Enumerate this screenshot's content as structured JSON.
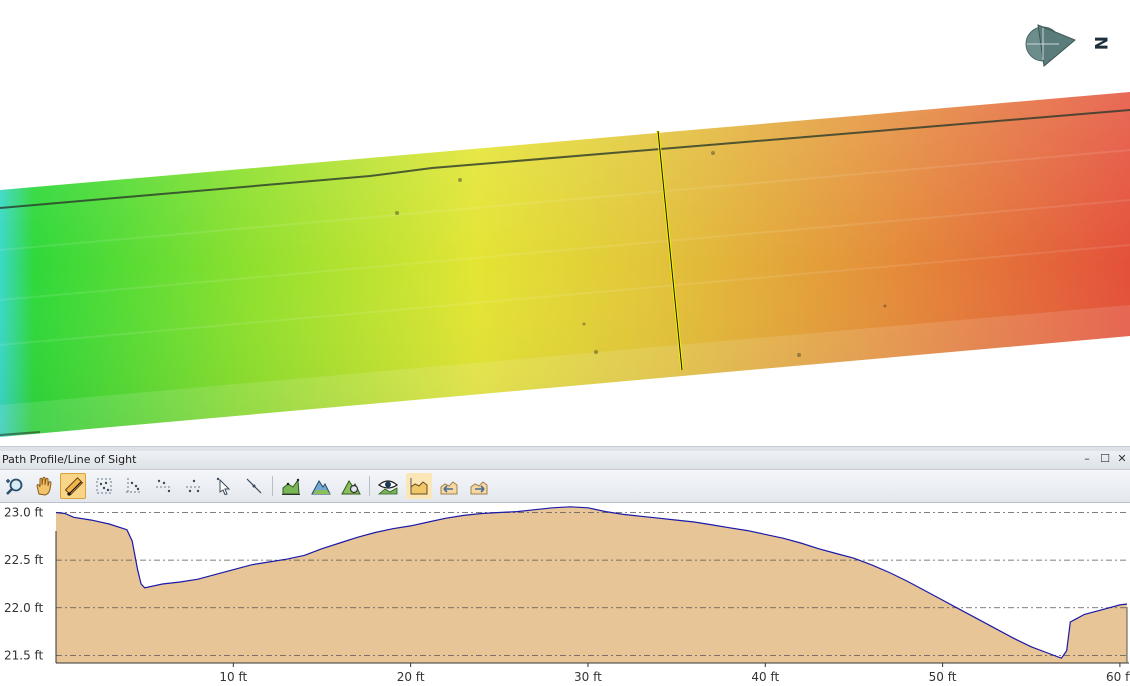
{
  "panel": {
    "title": "Path Profile/Line of Sight",
    "minimize_label": "–",
    "maximize_label": "☐",
    "close_label": "✕"
  },
  "compass": {
    "north_label": "N"
  },
  "toolbar": {
    "tools": [
      {
        "name": "zoom-tool",
        "icon": "zoom-icon"
      },
      {
        "name": "pan-tool",
        "icon": "hand-icon"
      },
      {
        "name": "measure-path-tool",
        "icon": "ruler-icon",
        "active": true
      },
      {
        "name": "select-points-tool",
        "icon": "point-select-icon"
      },
      {
        "name": "edit-points-tool",
        "icon": "point-edit-icon"
      },
      {
        "name": "add-vertex-tool",
        "icon": "vertex-add-icon"
      },
      {
        "name": "insert-vertex-tool",
        "icon": "vertex-insert-icon"
      },
      {
        "name": "select-arrow-tool",
        "icon": "arrow-select-icon"
      },
      {
        "name": "line-tool",
        "icon": "line-icon"
      },
      {
        "name": "profile-chart-tool",
        "icon": "profile-chart-icon"
      },
      {
        "name": "terrain-tool",
        "icon": "terrain-icon"
      },
      {
        "name": "terrain-settings-tool",
        "icon": "terrain-settings-icon"
      },
      {
        "name": "line-of-sight-tool",
        "icon": "eye-icon"
      },
      {
        "name": "profile-view-tool",
        "icon": "profile-view-icon"
      },
      {
        "name": "profile-back-tool",
        "icon": "profile-back-icon"
      },
      {
        "name": "profile-forward-tool",
        "icon": "profile-forward-icon"
      }
    ]
  },
  "chart_data": {
    "type": "area",
    "title": "",
    "xlabel": "",
    "ylabel": "",
    "xlim": [
      0,
      60.4
    ],
    "ylim": [
      21.42,
      23.1
    ],
    "y_ticks": [
      23.0,
      22.5,
      22.0,
      21.5
    ],
    "y_tick_labels": [
      "23.0 ft",
      "22.5 ft",
      "22.0 ft",
      "21.5 ft"
    ],
    "x_ticks": [
      10,
      20,
      30,
      40,
      50,
      60
    ],
    "x_tick_labels": [
      "10 ft",
      "20 ft",
      "30 ft",
      "40 ft",
      "50 ft",
      "60 ft"
    ],
    "grid": "horizontal-dashdot",
    "fill_color": "#e8c596",
    "line_color": "#1a1aa8",
    "series": [
      {
        "x": [
          0,
          0.5,
          1,
          2,
          3,
          4,
          4.3,
          4.6,
          4.8,
          5,
          6,
          7,
          8,
          9,
          10,
          11,
          12,
          13,
          14,
          15,
          16,
          17,
          18,
          19,
          20,
          21,
          22,
          23,
          24,
          25,
          26,
          27,
          28,
          29,
          30,
          31,
          32,
          33,
          34,
          35,
          36,
          37,
          38,
          39,
          40,
          41,
          42,
          43,
          44,
          45,
          46,
          47,
          48,
          49,
          50,
          51,
          52,
          53,
          54,
          55,
          56,
          56.7,
          57,
          57.2,
          57.5,
          58,
          59,
          60,
          60.4
        ],
        "y": [
          23.0,
          22.99,
          22.95,
          22.92,
          22.88,
          22.82,
          22.7,
          22.4,
          22.25,
          22.21,
          22.25,
          22.27,
          22.3,
          22.35,
          22.4,
          22.45,
          22.48,
          22.51,
          22.55,
          22.62,
          22.68,
          22.74,
          22.79,
          22.83,
          22.86,
          22.9,
          22.94,
          22.97,
          22.99,
          23.0,
          23.01,
          23.03,
          23.05,
          23.06,
          23.05,
          23.01,
          22.98,
          22.96,
          22.94,
          22.92,
          22.9,
          22.87,
          22.84,
          22.81,
          22.77,
          22.73,
          22.68,
          22.62,
          22.57,
          22.52,
          22.45,
          22.37,
          22.28,
          22.18,
          22.08,
          21.98,
          21.88,
          21.78,
          21.68,
          21.59,
          21.52,
          21.47,
          21.55,
          21.85,
          21.88,
          21.93,
          21.98,
          22.03,
          22.04
        ]
      }
    ]
  }
}
